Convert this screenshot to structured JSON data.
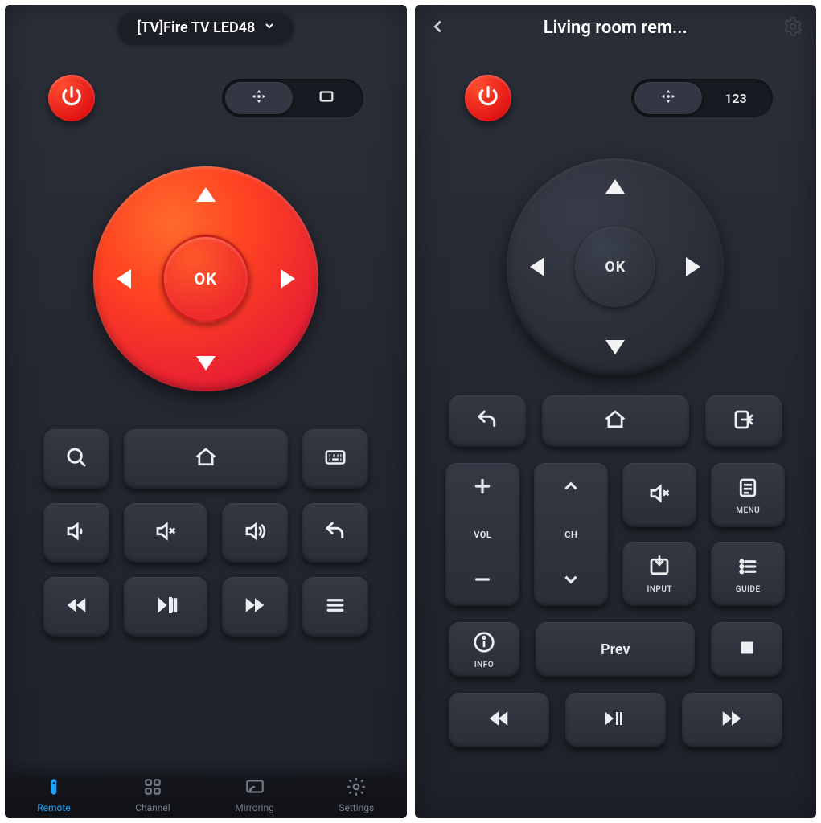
{
  "left": {
    "device_name": "[TV]Fire TV LED48",
    "ok_label": "OK",
    "nav": {
      "remote": "Remote",
      "channel": "Channel",
      "mirroring": "Mirroring",
      "settings": "Settings"
    }
  },
  "right": {
    "title": "Living room rem...",
    "ok_label": "OK",
    "mode_num_label": "123",
    "labels": {
      "vol": "VOL",
      "ch": "CH",
      "menu": "MENU",
      "input": "INPUT",
      "guide": "GUIDE",
      "info": "INFO",
      "prev": "Prev"
    }
  },
  "colors": {
    "accent_red_a": "#ff5a2b",
    "accent_red_b": "#e21a2c",
    "accent_blue": "#1aa3ff",
    "bg_dark": "#23262f"
  }
}
